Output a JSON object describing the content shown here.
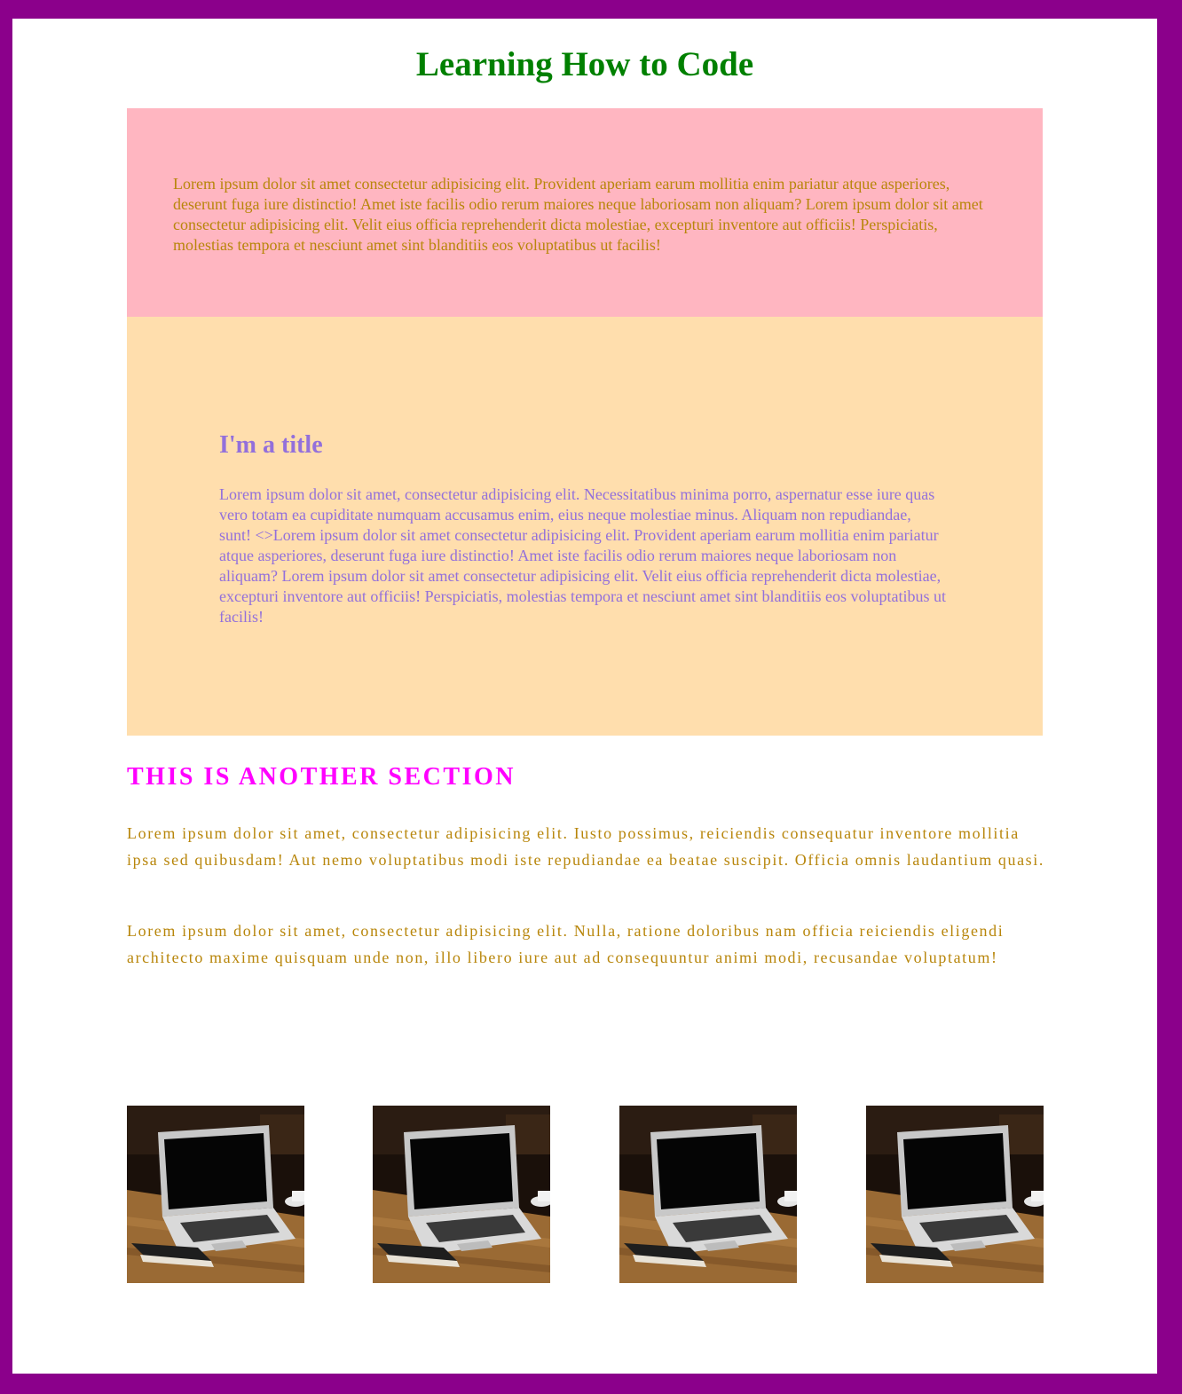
{
  "page": {
    "title": "Learning How to Code",
    "colors": {
      "border": "#8b008b",
      "title": "#008000",
      "pink_box": "#ffb6c1",
      "tan_box": "#ffdead",
      "gold_text": "#b8860b",
      "purple_text": "#9370db",
      "magenta_heading": "#ff00ff"
    }
  },
  "pink_section": {
    "text": "Lorem ipsum dolor sit amet consectetur adipisicing elit. Provident aperiam earum mollitia enim pariatur atque asperiores, deserunt fuga iure distinctio! Amet iste facilis odio rerum maiores neque laboriosam non aliquam? Lorem ipsum dolor sit amet consectetur adipisicing elit. Velit eius officia reprehenderit dicta molestiae, excepturi inventore aut officiis! Perspiciatis, molestias tempora et nesciunt amet sint blanditiis eos voluptatibus ut facilis!"
  },
  "tan_section": {
    "title": "I'm a title",
    "text": "Lorem ipsum dolor sit amet, consectetur adipisicing elit. Necessitatibus minima porro, aspernatur esse iure quas vero totam ea cupiditate numquam accusamus enim, eius neque molestiae minus. Aliquam non repudiandae, sunt! <>Lorem ipsum dolor sit amet consectetur adipisicing elit. Provident aperiam earum mollitia enim pariatur atque asperiores, deserunt fuga iure distinctio! Amet iste facilis odio rerum maiores neque laboriosam non aliquam? Lorem ipsum dolor sit amet consectetur adipisicing elit. Velit eius officia reprehenderit dicta molestiae, excepturi inventore aut officiis! Perspiciatis, molestias tempora et nesciunt amet sint blanditiis eos voluptatibus ut facilis!"
  },
  "another_section": {
    "heading": "THIS IS ANOTHER SECTION",
    "paragraphs": [
      "Lorem ipsum dolor sit amet, consectetur adipisicing elit. Iusto possimus, reiciendis consequatur inventore mollitia ipsa sed quibusdam! Aut nemo voluptatibus modi iste repudiandae ea beatae suscipit. Officia omnis laudantium quasi.",
      "Lorem ipsum dolor sit amet, consectetur adipisicing elit. Nulla, ratione doloribus nam officia reiciendis eligendi architecto maxime quisquam unde non, illo libero iure aut ad consequuntur animi modi, recusandae voluptatum!"
    ]
  },
  "gallery": {
    "images": [
      {
        "subject": "laptop-on-wooden-table"
      },
      {
        "subject": "laptop-on-wooden-table"
      },
      {
        "subject": "laptop-on-wooden-table"
      },
      {
        "subject": "laptop-on-wooden-table"
      }
    ]
  }
}
